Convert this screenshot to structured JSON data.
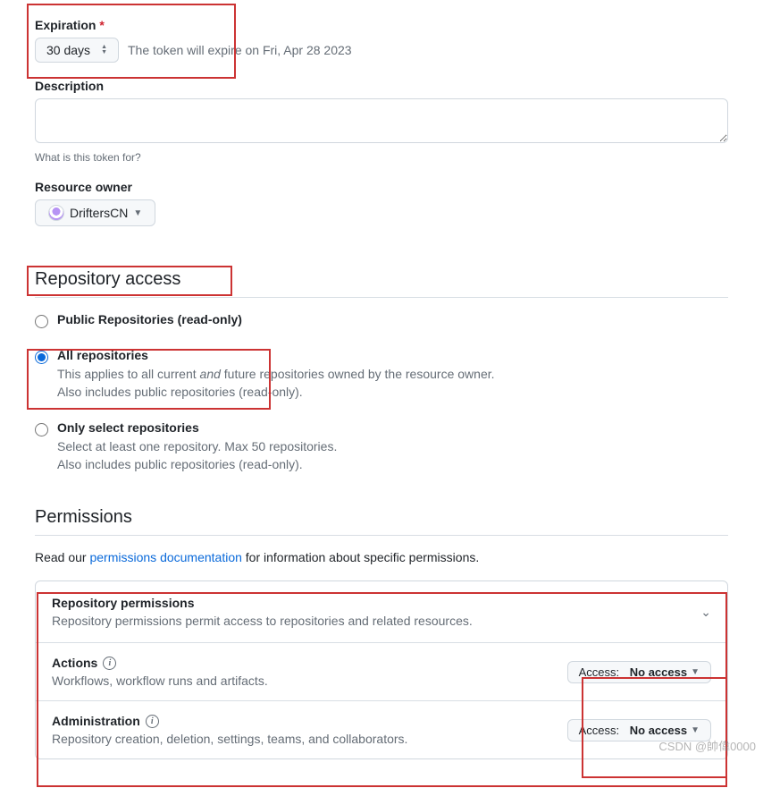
{
  "expiration": {
    "label": "Expiration",
    "value": "30 days",
    "hint": "The token will expire on Fri, Apr 28 2023"
  },
  "description": {
    "label": "Description",
    "helper": "What is this token for?"
  },
  "owner": {
    "label": "Resource owner",
    "value": "DriftersCN"
  },
  "repo_access": {
    "heading": "Repository access",
    "options": [
      {
        "title": "Public Repositories (read-only)"
      },
      {
        "title": "All repositories",
        "desc_pre": "This applies to all current ",
        "desc_em": "and",
        "desc_post": " future repositories owned by the resource owner.",
        "desc_line2": "Also includes public repositories (read-only)."
      },
      {
        "title": "Only select repositories",
        "desc1": "Select at least one repository. Max 50 repositories.",
        "desc2": "Also includes public repositories (read-only)."
      }
    ]
  },
  "permissions": {
    "heading": "Permissions",
    "intro_pre": "Read our ",
    "intro_link": "permissions documentation",
    "intro_post": " for information about specific permissions.",
    "group_title": "Repository permissions",
    "group_desc": "Repository permissions permit access to repositories and related resources.",
    "access_label": "Access:",
    "rows": [
      {
        "title": "Actions",
        "desc": "Workflows, workflow runs and artifacts.",
        "access": "No access"
      },
      {
        "title": "Administration",
        "desc": "Repository creation, deletion, settings, teams, and collaborators.",
        "access": "No access"
      }
    ]
  },
  "watermark": "CSDN @帥偉0000"
}
